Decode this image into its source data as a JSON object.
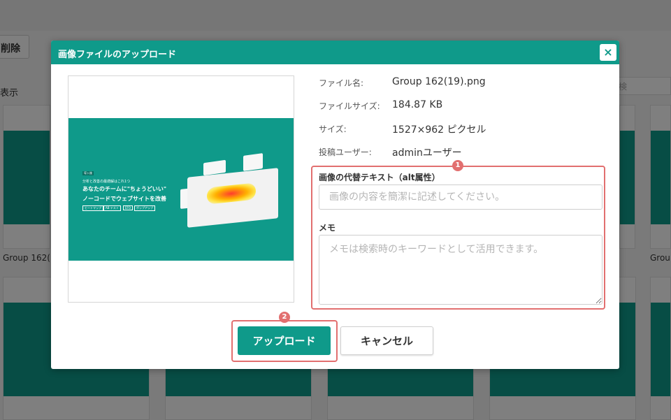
{
  "background": {
    "delete_label": "削除",
    "view_label": "表示",
    "search_placeholder": "検",
    "cards": [
      {
        "caption": "Group 162(19"
      },
      {
        "caption": "Grou"
      }
    ]
  },
  "modal": {
    "title": "画像ファイルのアップロード",
    "close_label": "×",
    "preview": {
      "tag": "導入後",
      "heading_small": "分析と改善の最適解はこれ1つ",
      "line1": "あなたのチームに\"ちょうどいい\"",
      "line2": "ノーコードでウェブサイトを改善",
      "pill1": "ヒートマップ",
      "pill2": "AB テスト",
      "pill3": "EFO",
      "pill4": "ポップアップ"
    },
    "info": [
      {
        "label": "ファイル名:",
        "value": "Group 162(19).png"
      },
      {
        "label": "ファイルサイズ:",
        "value": "184.87 KB"
      },
      {
        "label": "サイズ:",
        "value": "1527×962 ピクセル"
      },
      {
        "label": "投稿ユーザー:",
        "value": "adminユーザー"
      }
    ],
    "alt": {
      "label": "画像の代替テキスト（alt属性）",
      "value": "",
      "placeholder": "画像の内容を簡潔に記述してください。"
    },
    "memo": {
      "label": "メモ",
      "value": "",
      "placeholder": "メモは検索時のキーワードとして活用できます。"
    },
    "badges": {
      "one": "1",
      "two": "2"
    },
    "upload_label": "アップロード",
    "cancel_label": "キャンセル"
  },
  "colors": {
    "accent": "#0f9a8a",
    "highlight": "#e26f6f"
  }
}
